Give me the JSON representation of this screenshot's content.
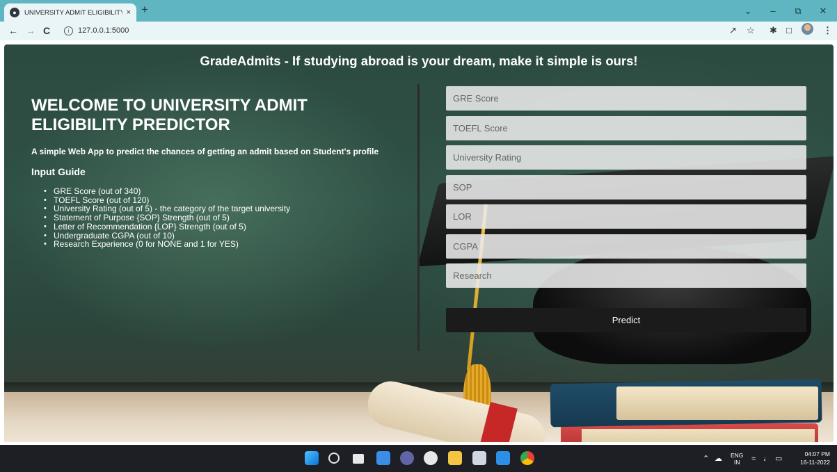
{
  "browser": {
    "tab_title": "UNIVERSITY ADMIT ELIGIBILITY P",
    "tab_close": "×",
    "new_tab": "+",
    "url": "127.0.0.1:5000"
  },
  "page": {
    "header": "GradeAdmits - If studying abroad is your dream, make it simple is ours!",
    "welcome": "WELCOME TO UNIVERSITY ADMIT ELIGIBILITY PREDICTOR",
    "subtitle": "A simple Web App to predict the chances of getting an admit based on Student's profile",
    "guide_title": "Input Guide",
    "guide_items": [
      "GRE Score (out of 340)",
      "TOEFL Score (out of 120)",
      "University Rating (out of 5) - the category of the target university",
      "Statement of Purpose {SOP} Strength (out of 5)",
      "Letter of Recommendation {LOP} Strength (out of 5)",
      "Undergraduate CGPA (out of 10)",
      "Research Experience (0 for NONE and 1 for YES)"
    ]
  },
  "form": {
    "fields": [
      {
        "placeholder": "GRE Score",
        "value": ""
      },
      {
        "placeholder": "TOEFL Score",
        "value": ""
      },
      {
        "placeholder": "University Rating",
        "value": ""
      },
      {
        "placeholder": "SOP",
        "value": ""
      },
      {
        "placeholder": "LOR",
        "value": ""
      },
      {
        "placeholder": "CGPA",
        "value": ""
      },
      {
        "placeholder": "Research",
        "value": ""
      }
    ],
    "submit_label": "Predict"
  },
  "taskbar": {
    "lang_line1": "ENG",
    "lang_line2": "IN",
    "time": "04:07 PM",
    "date": "16-11-2022"
  },
  "colors": {
    "tab_strip": "#5fb6c2",
    "toolbar": "#e9f5f7",
    "predict_button": "#1b1b1b",
    "taskbar": "#1d1f24"
  }
}
